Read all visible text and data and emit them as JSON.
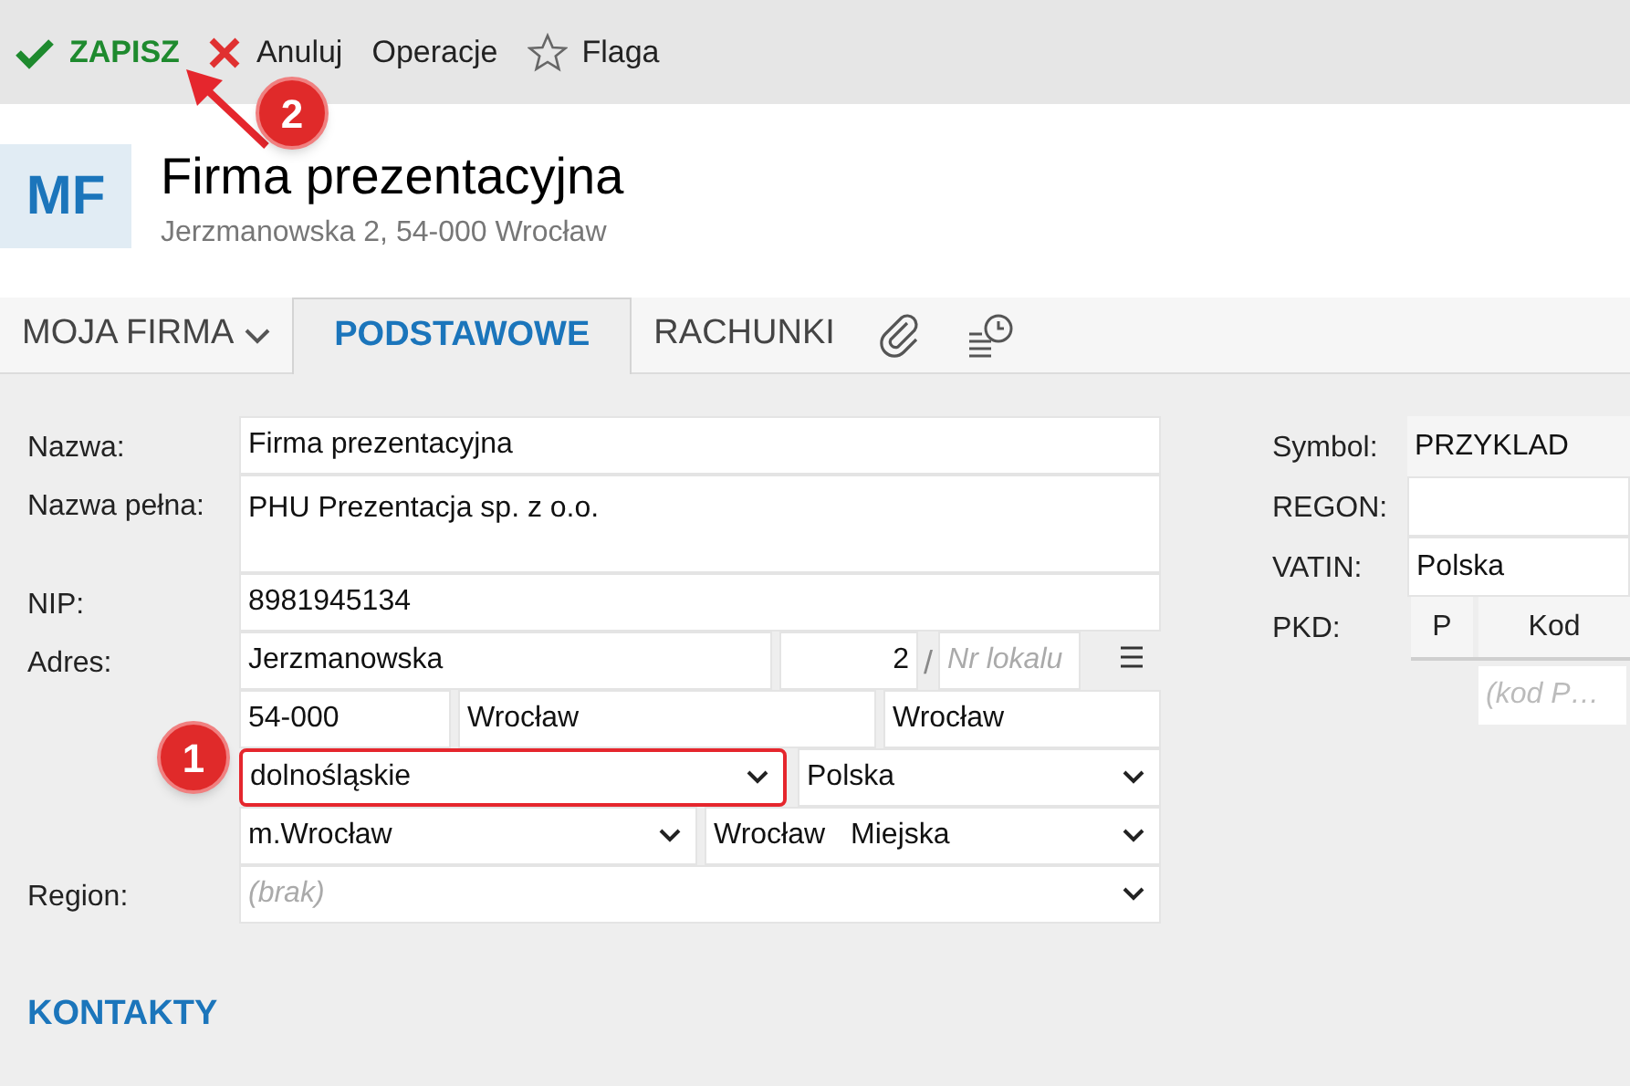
{
  "toolbar": [
    {
      "kind": "save",
      "label": "ZAPISZ"
    },
    {
      "kind": "cancel",
      "label": "Anuluj"
    },
    {
      "kind": "plain",
      "label": "Operacje"
    },
    {
      "kind": "flag",
      "label": "Flaga"
    }
  ],
  "header": {
    "initials": "MF",
    "title": "Firma prezentacyjna",
    "address": "Jerzmanowska 2, 54-000 Wrocław"
  },
  "tabs": [
    {
      "kind": "dropdown",
      "label": "MOJA FIRMA",
      "selected": false
    },
    {
      "kind": "text",
      "label": "PODSTAWOWE",
      "selected": true
    },
    {
      "kind": "text",
      "label": "RACHUNKI",
      "selected": false
    },
    {
      "kind": "attachments",
      "selected": false
    },
    {
      "kind": "history",
      "selected": false
    }
  ],
  "basic": {
    "name": {
      "label": "Nazwa:",
      "value": "Firma prezentacyjna"
    },
    "full_name": {
      "label": "Nazwa pełna:",
      "value": "PHU Prezentacja sp. z o.o."
    },
    "nip": {
      "label": "NIP:",
      "value": "8981945134"
    },
    "address": {
      "label": "Adres:",
      "street": "Jerzmanowska",
      "building": "2",
      "separator": "/",
      "unit_placeholder": "Nr lokalu",
      "postal_code": "54-000",
      "post_office": "Wrocław",
      "city": "Wrocław",
      "voivodeship": {
        "value": "dolnośląskie",
        "highlighted": true
      },
      "country": {
        "value": "Polska",
        "highlighted": false
      },
      "county": {
        "value": "m.Wrocław",
        "highlighted": false
      },
      "commune": {
        "value": "Wrocław",
        "type": "Miejska",
        "highlighted": false
      }
    },
    "region": {
      "label": "Region:",
      "placeholder": "(brak)"
    }
  },
  "details": {
    "symbol": {
      "label": "Symbol:",
      "value": "PRZYKLAD",
      "readonly": true
    },
    "regon": {
      "label": "REGON:",
      "readonly": false
    },
    "vatin": {
      "label": "VATIN:",
      "value": "Polska",
      "readonly": false
    },
    "pkd": {
      "label": "PKD:",
      "columns": [
        "P",
        "Kod"
      ],
      "new_row_placeholder": "(kod P…"
    }
  },
  "section": "KONTAKTY",
  "annotations": [
    {
      "label": "1"
    },
    {
      "label": "2"
    }
  ]
}
